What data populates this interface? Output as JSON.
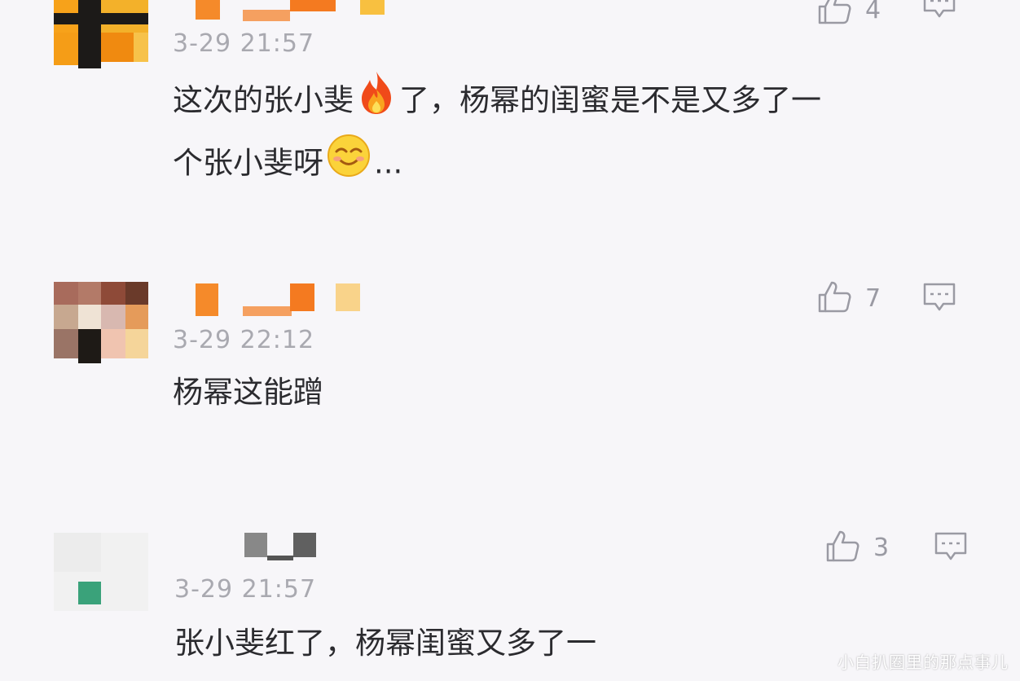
{
  "comments": [
    {
      "time": "3-29 21:57",
      "text_part1": "这次的张小斐",
      "text_part2": "了，杨幂的闺蜜是不是又多了一",
      "text_line2": "个张小斐呀",
      "text_tail": "...",
      "likes": "4",
      "emojis": [
        "fire-emoji",
        "smiling-face-emoji"
      ]
    },
    {
      "time": "3-29 22:12",
      "text": "杨幂这能蹭",
      "likes": "7"
    },
    {
      "time": "3-29 21:57",
      "text": "张小斐红了，杨幂闺蜜又多了一",
      "likes": "3"
    }
  ],
  "icons": {
    "like": "thumbs-up-icon",
    "reply": "comment-bubble-icon"
  },
  "watermark": "小白扒圈里的那点事儿",
  "colors": {
    "background": "#f7f6f9",
    "text": "#2b2b2f",
    "meta": "#a9a9b0",
    "icon": "#9a9aa3"
  }
}
